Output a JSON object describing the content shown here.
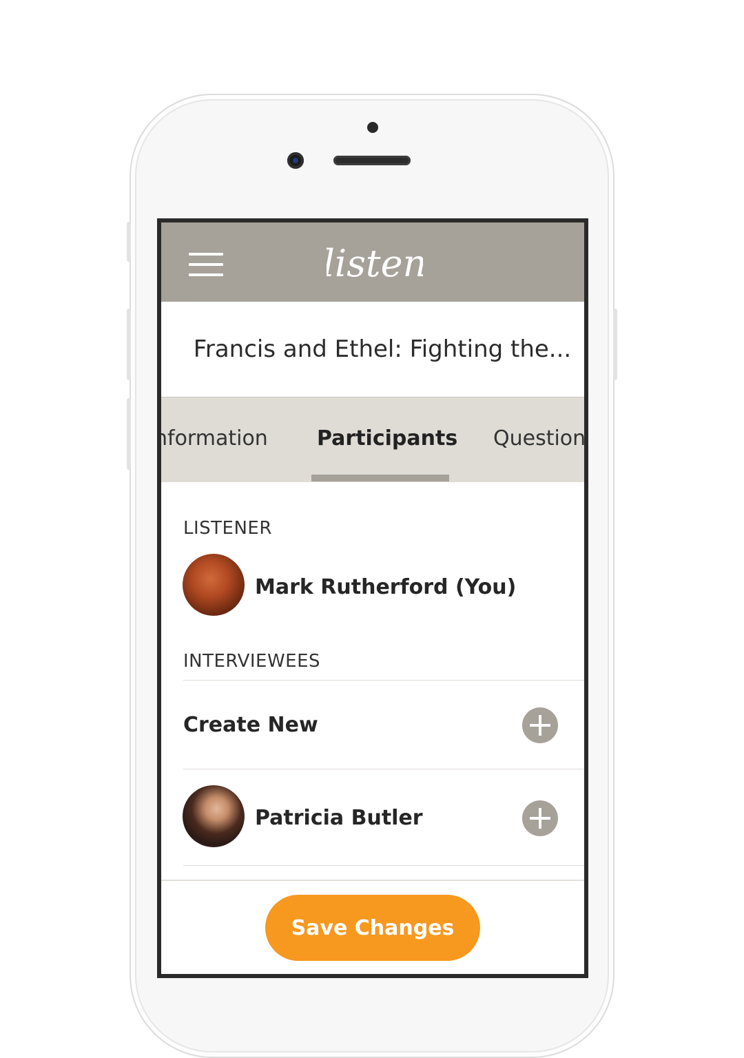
{
  "app": {
    "logo_text": "listen"
  },
  "header": {
    "title": "Francis and Ethel: Fighting the..."
  },
  "tabs": [
    {
      "label": "nformation"
    },
    {
      "label": "Participants"
    },
    {
      "label": "Question"
    }
  ],
  "listener": {
    "section_label": "LISTENER",
    "name": "Mark Rutherford (You)"
  },
  "interviewees": {
    "section_label": "INTERVIEWEES",
    "create_label": "Create New",
    "people": [
      {
        "name": "Patricia Butler"
      }
    ]
  },
  "footer": {
    "save_label": "Save Changes"
  },
  "colors": {
    "accent": "#f7981f",
    "appbar": "#a6a199",
    "tabbar": "#dfdcd6"
  },
  "icons": [
    "menu-icon",
    "plus-icon",
    "logo-icon"
  ]
}
